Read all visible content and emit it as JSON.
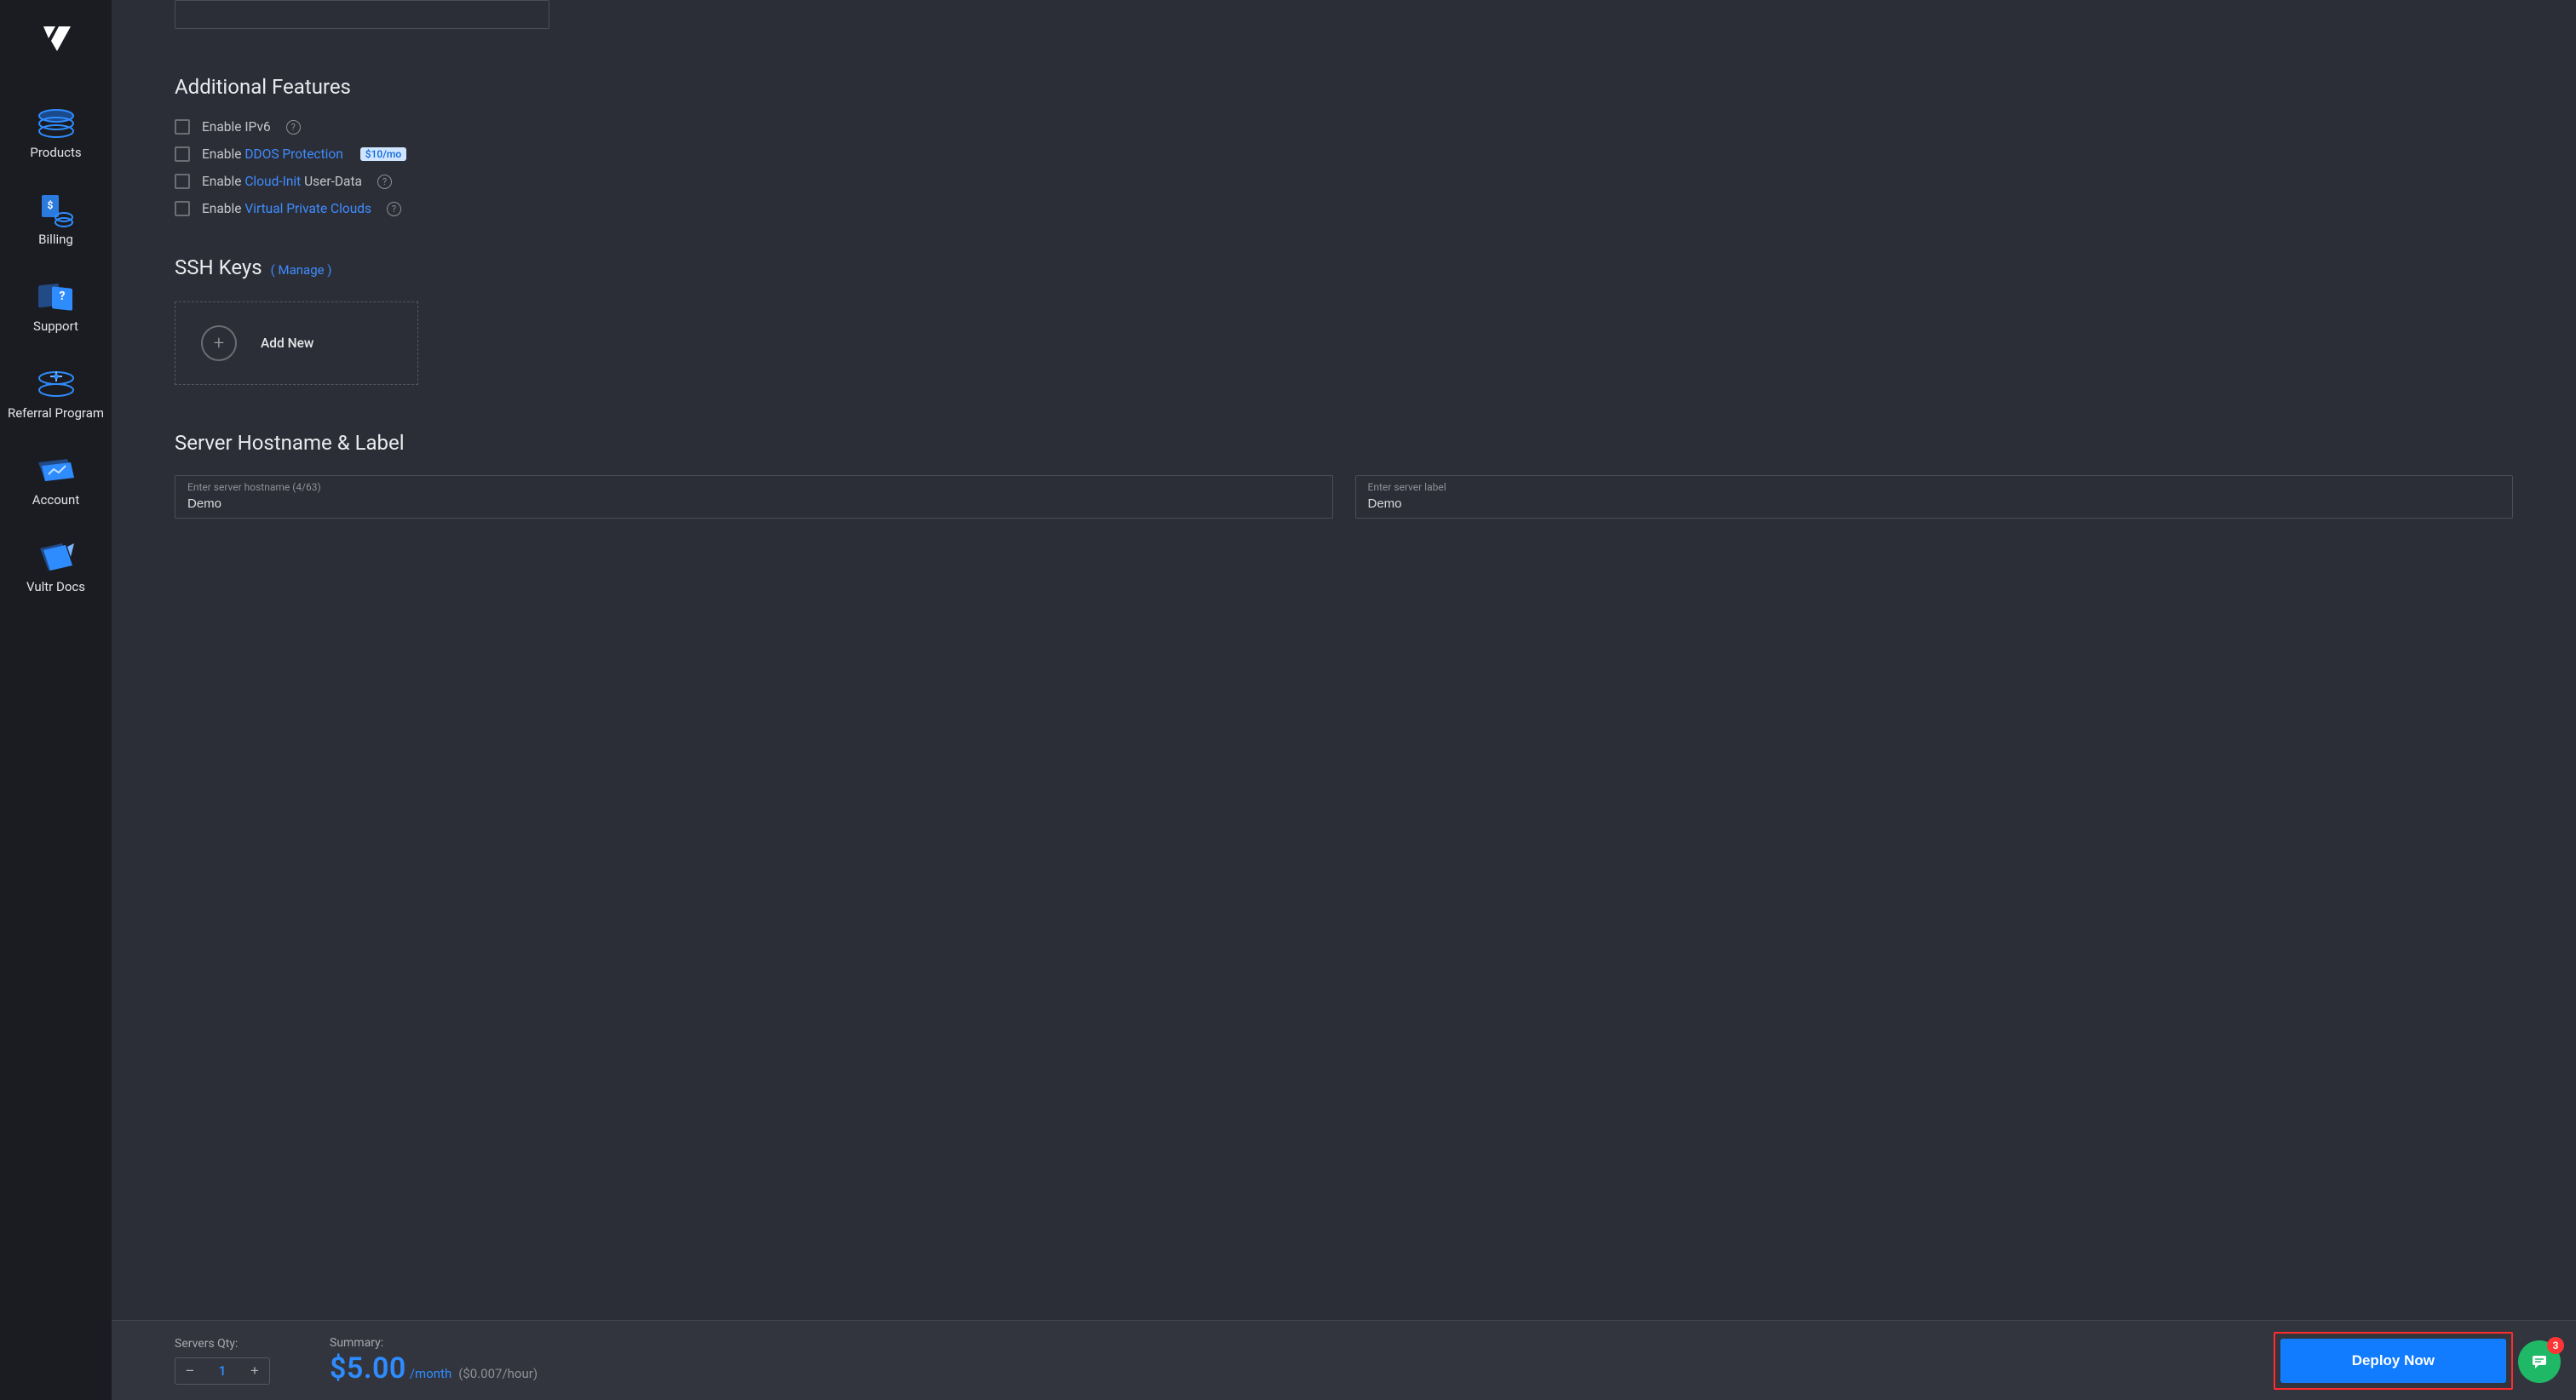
{
  "sidebar": {
    "items": [
      {
        "label": "Products"
      },
      {
        "label": "Billing"
      },
      {
        "label": "Support"
      },
      {
        "label": "Referral Program"
      },
      {
        "label": "Account"
      },
      {
        "label": "Vultr Docs"
      }
    ]
  },
  "features": {
    "title": "Additional Features",
    "ipv6": {
      "prefix": "Enable IPv6"
    },
    "ddos": {
      "prefix": "Enable ",
      "link": "DDOS Protection",
      "badge": "$10/mo"
    },
    "cloudinit": {
      "prefix": "Enable ",
      "link": "Cloud-Init",
      "suffix": " User-Data"
    },
    "vpc": {
      "prefix": "Enable ",
      "link": "Virtual Private Clouds"
    }
  },
  "ssh": {
    "title": "SSH Keys",
    "manage": "( Manage )",
    "add_new": "Add New"
  },
  "hostname_section": {
    "title": "Server Hostname & Label",
    "hostname_label": "Enter server hostname (4/63)",
    "hostname_value": "Demo",
    "label_label": "Enter server label",
    "label_value": "Demo"
  },
  "footer": {
    "qty_label": "Servers Qty:",
    "qty_value": "1",
    "summary_label": "Summary:",
    "price": "$5.00",
    "price_unit": "/month",
    "price_hour": "($0.007/hour)",
    "deploy": "Deploy Now"
  },
  "chat": {
    "badge": "3"
  }
}
